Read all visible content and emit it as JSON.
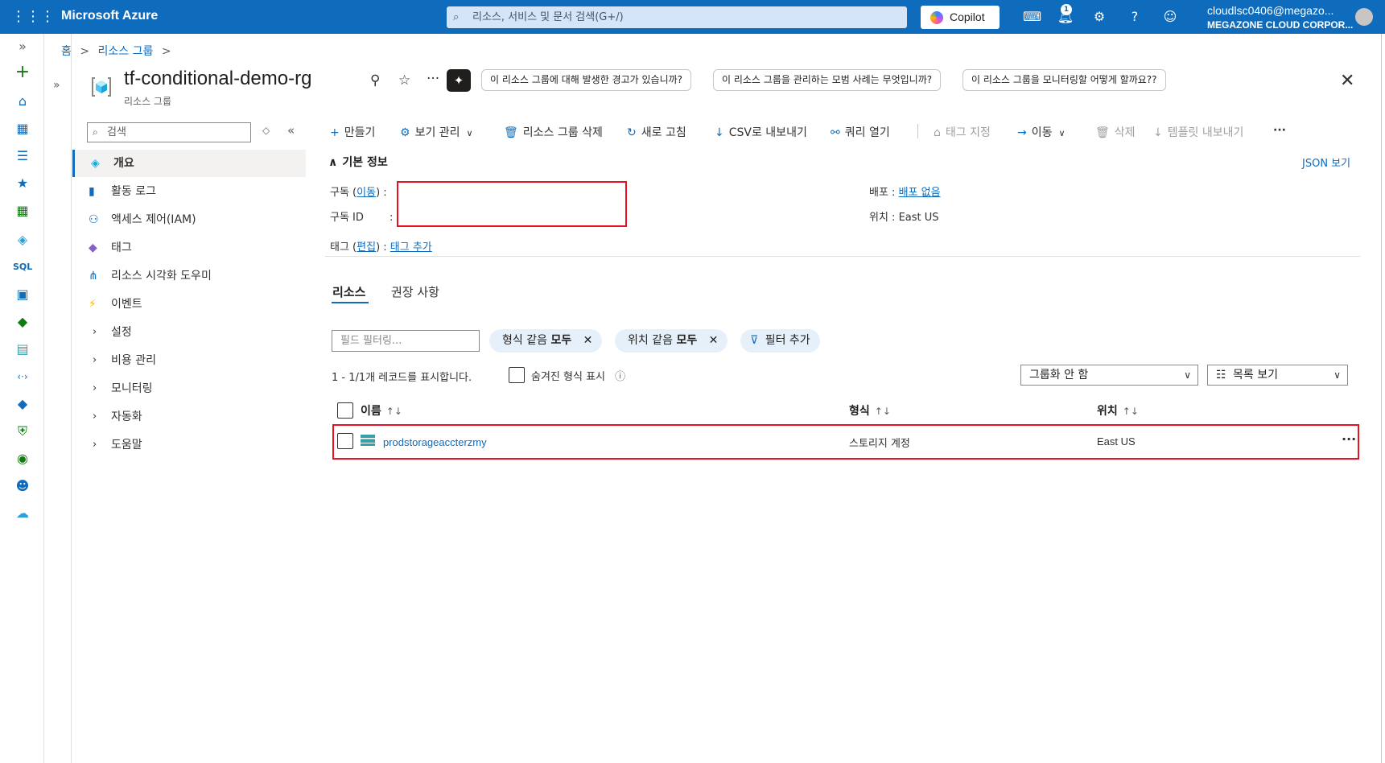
{
  "topbar": {
    "brand": "Microsoft Azure",
    "search_placeholder": "리소스, 서비스 및 문서 검색(G+/)",
    "copilot_label": "Copilot",
    "notification_count": "1",
    "user_name": "cloudlsc0406@megazo...",
    "user_org": "MEGAZONE CLOUD CORPOR..."
  },
  "breadcrumb": {
    "home": "홈",
    "resource_groups": "리소스 그룹",
    "sep": ">"
  },
  "header": {
    "title": "tf-conditional-demo-rg",
    "subtitle": "리소스 그룹",
    "prompts": [
      "이 리소스 그룹에 대해 발생한 경고가 있습니까?",
      "이 리소스 그룹을 관리하는 모범 사례는 무엇입니까?",
      "이 리소스 그룹을 모니터링할 어떻게 할까요??"
    ]
  },
  "menu": {
    "search_placeholder": "검색",
    "items": [
      {
        "label": "개요"
      },
      {
        "label": "활동 로그"
      },
      {
        "label": "액세스 제어(IAM)"
      },
      {
        "label": "태그"
      },
      {
        "label": "리소스 시각화 도우미"
      },
      {
        "label": "이벤트"
      },
      {
        "label": "설정"
      },
      {
        "label": "비용 관리"
      },
      {
        "label": "모니터링"
      },
      {
        "label": "자동화"
      },
      {
        "label": "도움말"
      }
    ]
  },
  "toolbar": {
    "create": "만들기",
    "manage_view": "보기 관리",
    "delete_rg": "리소스 그룹 삭제",
    "refresh": "새로 고침",
    "export_csv": "CSV로 내보내기",
    "open_query": "쿼리 열기",
    "assign_tags": "태그 지정",
    "move": "이동",
    "delete": "삭제",
    "export_template": "템플릿 내보내기",
    "more": "···"
  },
  "essentials": {
    "heading": "기본 정보",
    "json_view": "JSON 보기",
    "subscription_label": "구독",
    "subscription_move": "이동",
    "subscription_id_label": "구독 ID",
    "tags_label": "태그",
    "tags_edit": "편집",
    "tags_add": "태그 추가",
    "deployments_label": "배포",
    "deployments_value": "배포 없음",
    "location_label": "위치",
    "location_value": "East US"
  },
  "tabs": {
    "resources": "리소스",
    "recommendations": "권장 사항"
  },
  "filters": {
    "field_placeholder": "필드 필터링...",
    "type_prefix": "형식 같음",
    "type_value": "모두",
    "loc_prefix": "위치 같음",
    "loc_value": "모두",
    "add_filter": "필터 추가"
  },
  "records": {
    "count_text": "1 - 1/1개 레코드를 표시합니다.",
    "show_hidden": "숨겨진 형식 표시",
    "grouping": "그룹화 안 함",
    "view": "목록 보기"
  },
  "table": {
    "columns": [
      "이름",
      "형식",
      "위치"
    ],
    "rows": [
      {
        "name": "prodstorageaccterzmy",
        "type": "스토리지 계정",
        "location": "East US"
      }
    ]
  },
  "colors": {
    "accent": "#0f6cbd",
    "highlight": "#e81123"
  }
}
